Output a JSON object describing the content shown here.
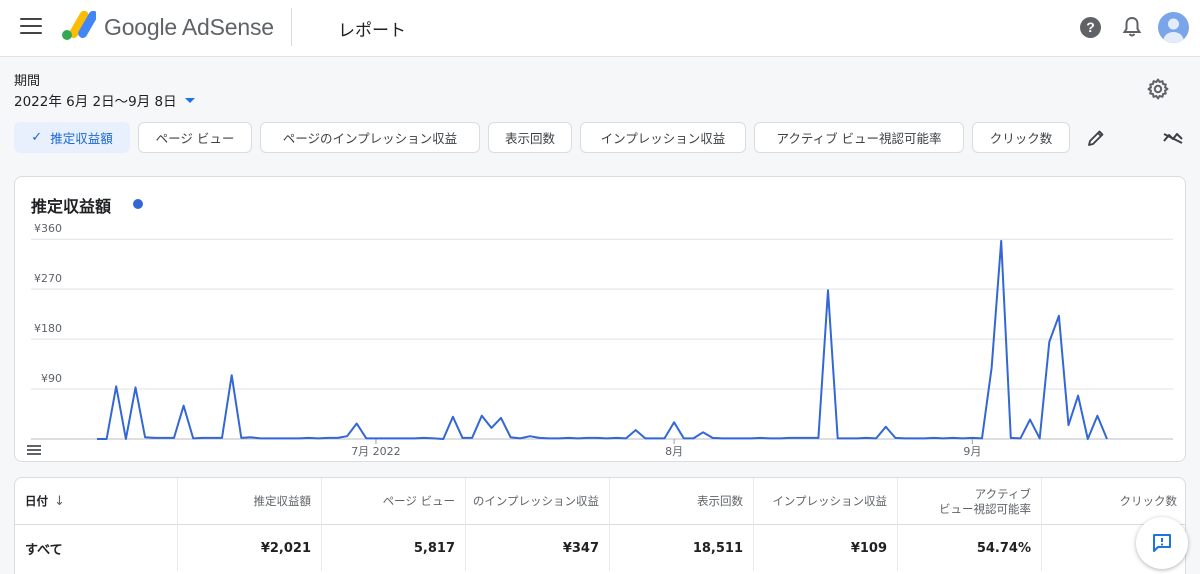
{
  "header": {
    "brand": "Google AdSense",
    "page_title": "レポート",
    "help_glyph": "?"
  },
  "period": {
    "label": "期間",
    "value": "2022年 6月 2日〜9月 8日"
  },
  "chips": [
    {
      "label": "推定収益額",
      "selected": true
    },
    {
      "label": "ページ ビュー",
      "selected": false
    },
    {
      "label": "ページのインプレッション収益",
      "selected": false
    },
    {
      "label": "表示回数",
      "selected": false
    },
    {
      "label": "インプレッション収益",
      "selected": false
    },
    {
      "label": "アクティブ ビュー視認可能率",
      "selected": false
    },
    {
      "label": "クリック数",
      "selected": false
    }
  ],
  "chart": {
    "title": "推定収益額",
    "series_color": "#3367d6"
  },
  "chart_data": {
    "type": "line",
    "x_tick_labels": [
      "7月 2022",
      "8月",
      "9月"
    ],
    "x_tick_day_index": [
      29,
      60,
      91
    ],
    "y_tick_labels": [
      "¥90",
      "¥180",
      "¥270",
      "¥360"
    ],
    "y_tick_values": [
      90,
      180,
      270,
      360
    ],
    "ylim": [
      0,
      400
    ],
    "grid": true,
    "series": [
      {
        "values": [
          0,
          0,
          95,
          0,
          93,
          3,
          2,
          2,
          2,
          60,
          1,
          2,
          2,
          2,
          115,
          2,
          3,
          1,
          1,
          1,
          1,
          1,
          2,
          1,
          2,
          2,
          5,
          28,
          1,
          1,
          1,
          1,
          1,
          1,
          2,
          1,
          0,
          40,
          2,
          2,
          42,
          20,
          38,
          3,
          1,
          5,
          2,
          1,
          1,
          2,
          1,
          2,
          2,
          1,
          2,
          1,
          16,
          1,
          1,
          1,
          30,
          1,
          1,
          12,
          2,
          1,
          1,
          1,
          1,
          2,
          1,
          1,
          2,
          2,
          2,
          2,
          268,
          1,
          1,
          1,
          2,
          1,
          22,
          2,
          1,
          1,
          1,
          2,
          1,
          2,
          1,
          2,
          1,
          128,
          357,
          2,
          1,
          35,
          1,
          175,
          222,
          25,
          78,
          0,
          42,
          0
        ]
      }
    ]
  },
  "table": {
    "headers": [
      "日付",
      "推定収益額",
      "ページ ビュー",
      "のインプレッション収益",
      "表示回数",
      "インプレッション収益",
      "アクティブ\nビュー視認可能率",
      "クリック数"
    ],
    "sort_glyph": "↓",
    "total_row": [
      "すべて",
      "¥2,021",
      "5,817",
      "¥347",
      "18,511",
      "¥109",
      "54.74%",
      ""
    ]
  },
  "colors": {
    "accent": "#1a73e8",
    "selected_chip_bg": "#e8f0fe",
    "line": "#3367d6"
  }
}
